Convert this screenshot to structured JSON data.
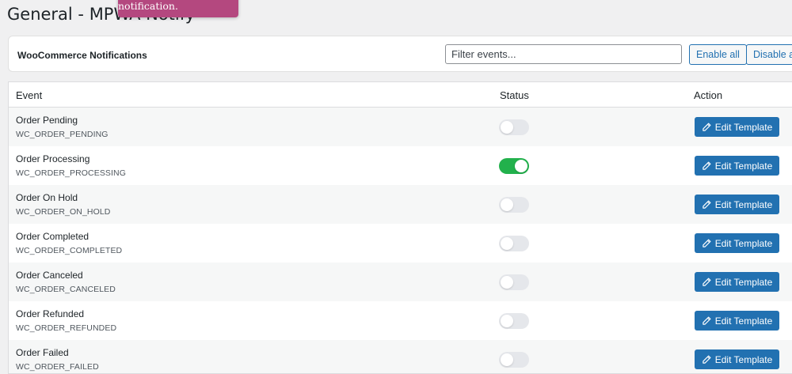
{
  "header": {
    "title": "General - MPWA Notify",
    "toast": "There is a new notification."
  },
  "card": {
    "title": "WooCommerce Notifications",
    "filter_placeholder": "Filter events...",
    "enable_all": "Enable all",
    "disable_all": "Disable all"
  },
  "table": {
    "columns": {
      "event": "Event",
      "status": "Status",
      "action": "Action"
    },
    "edit_label": "Edit Template",
    "rows": [
      {
        "name": "Order Pending",
        "code": "WC_ORDER_PENDING",
        "enabled": false
      },
      {
        "name": "Order Processing",
        "code": "WC_ORDER_PROCESSING",
        "enabled": true
      },
      {
        "name": "Order On Hold",
        "code": "WC_ORDER_ON_HOLD",
        "enabled": false
      },
      {
        "name": "Order Completed",
        "code": "WC_ORDER_COMPLETED",
        "enabled": false
      },
      {
        "name": "Order Canceled",
        "code": "WC_ORDER_CANCELED",
        "enabled": false
      },
      {
        "name": "Order Refunded",
        "code": "WC_ORDER_REFUNDED",
        "enabled": false
      },
      {
        "name": "Order Failed",
        "code": "WC_ORDER_FAILED",
        "enabled": false
      }
    ]
  },
  "colors": {
    "primary": "#2271b1",
    "toggle_on": "#22b14c",
    "toggle_off": "#e5e7eb",
    "toast": "#b4487f"
  },
  "icons": {
    "edit": "pencil-icon"
  }
}
